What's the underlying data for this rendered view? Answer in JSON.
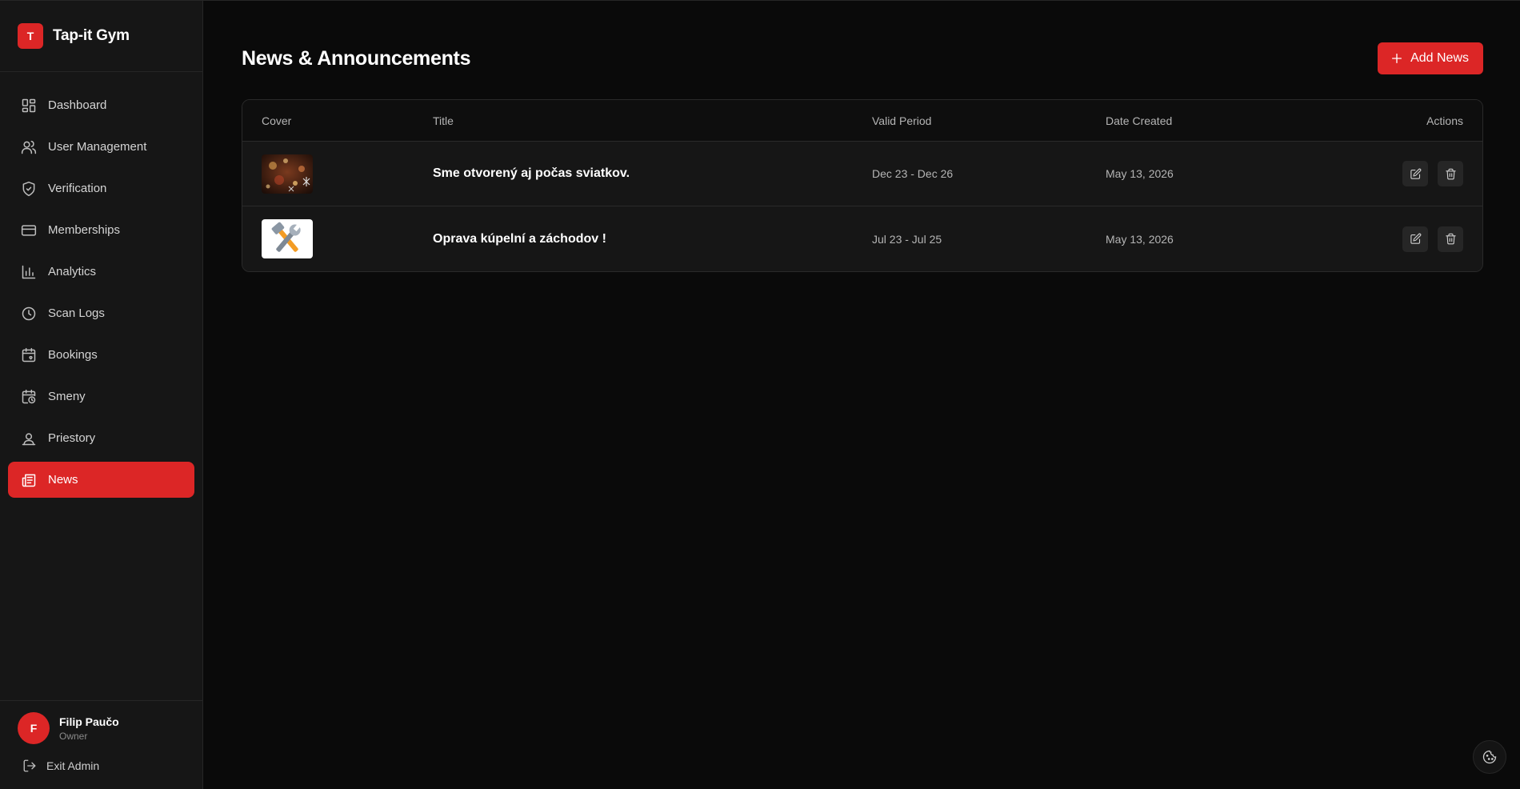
{
  "brand": {
    "logo_letter": "T",
    "name": "Tap-it Gym",
    "accent": "#dc2626"
  },
  "sidebar": {
    "items": [
      {
        "label": "Dashboard",
        "icon": "dashboard-icon",
        "active": false
      },
      {
        "label": "User Management",
        "icon": "users-icon",
        "active": false
      },
      {
        "label": "Verification",
        "icon": "shield-check-icon",
        "active": false
      },
      {
        "label": "Memberships",
        "icon": "credit-card-icon",
        "active": false
      },
      {
        "label": "Analytics",
        "icon": "bar-chart-icon",
        "active": false
      },
      {
        "label": "Scan Logs",
        "icon": "clock-icon",
        "active": false
      },
      {
        "label": "Bookings",
        "icon": "calendar-heart-icon",
        "active": false
      },
      {
        "label": "Smeny",
        "icon": "calendar-clock-icon",
        "active": false
      },
      {
        "label": "Priestory",
        "icon": "map-pin-user-icon",
        "active": false
      },
      {
        "label": "News",
        "icon": "newspaper-icon",
        "active": true
      }
    ]
  },
  "user": {
    "initial": "F",
    "name": "Filip Paučo",
    "role": "Owner"
  },
  "exit_label": "Exit Admin",
  "page": {
    "title": "News & Announcements",
    "add_button": "Add News"
  },
  "table": {
    "headers": {
      "cover": "Cover",
      "title": "Title",
      "period": "Valid Period",
      "created": "Date Created",
      "actions": "Actions"
    },
    "rows": [
      {
        "cover": "christmas-lights-image",
        "title": "Sme otvorený aj počas sviatkov.",
        "period": "Dec 23 - Dec 26",
        "created": "May 13, 2026"
      },
      {
        "cover": "tools-repair-image",
        "title": "Oprava kúpelní a záchodov !",
        "period": "Jul 23 - Jul 25",
        "created": "May 13, 2026"
      }
    ]
  }
}
